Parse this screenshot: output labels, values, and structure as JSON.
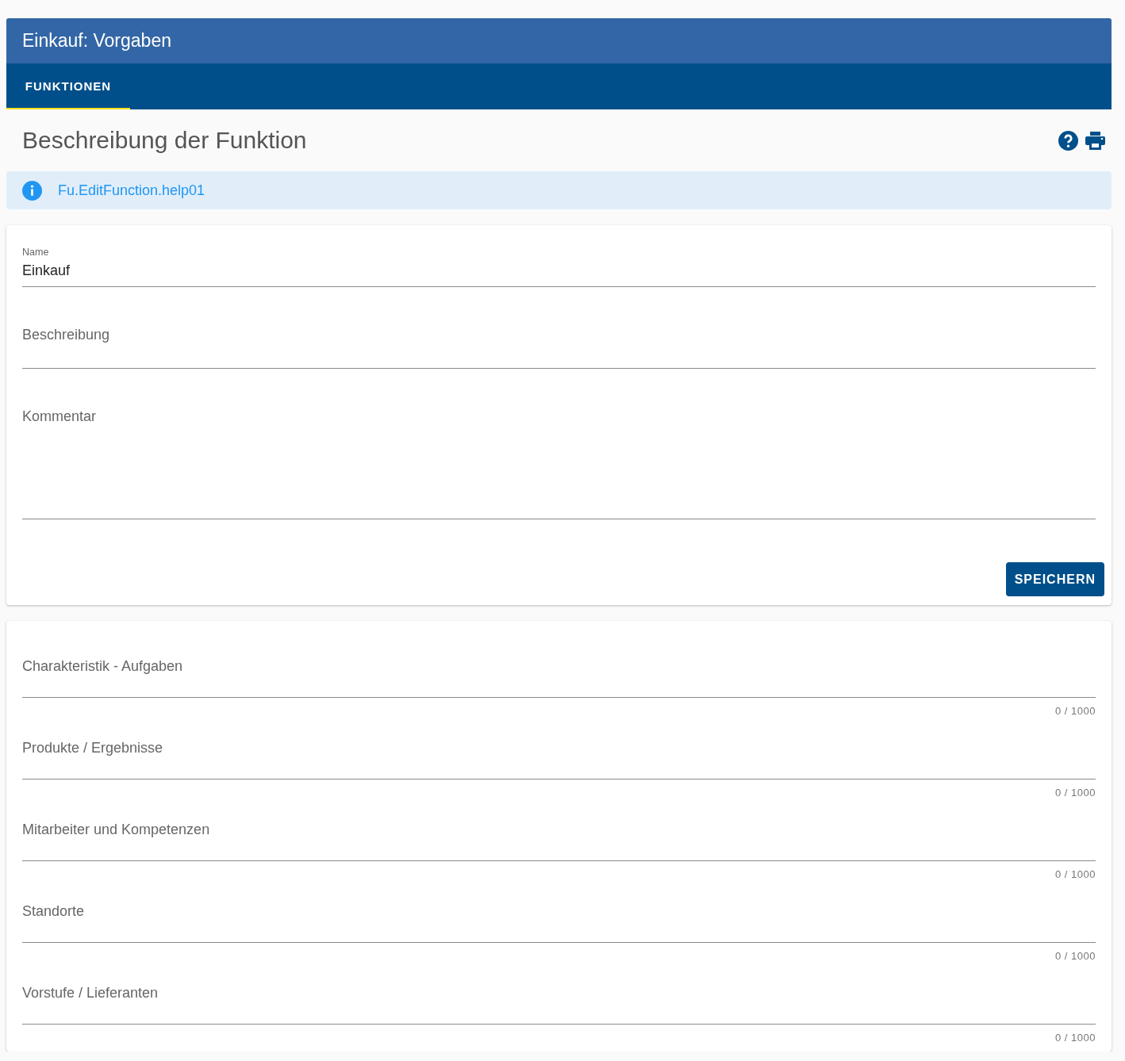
{
  "header": {
    "title": "Einkauf: Vorgaben"
  },
  "tabs": [
    {
      "label": "FUNKTIONEN",
      "selected": true
    }
  ],
  "section": {
    "title": "Beschreibung der Funktion"
  },
  "info": {
    "text": "Fu.EditFunction.help01"
  },
  "form": {
    "fields": [
      {
        "kind": "filled",
        "label": "Name",
        "value": "Einkauf"
      },
      {
        "kind": "text",
        "label": "Beschreibung"
      },
      {
        "kind": "textarea",
        "label": "Kommentar"
      }
    ],
    "button": "SPEICHERN"
  },
  "details": {
    "fields": [
      {
        "label": "Charakteristik - Aufgaben",
        "counter": "0 / 1000"
      },
      {
        "label": "Produkte / Ergebnisse",
        "counter": "0 / 1000"
      },
      {
        "label": "Mitarbeiter und Kompetenzen",
        "counter": "0 / 1000"
      },
      {
        "label": "Standorte",
        "counter": "0 / 1000"
      },
      {
        "label": "Vorstufe / Lieferanten",
        "counter": "0 / 1000"
      }
    ]
  }
}
